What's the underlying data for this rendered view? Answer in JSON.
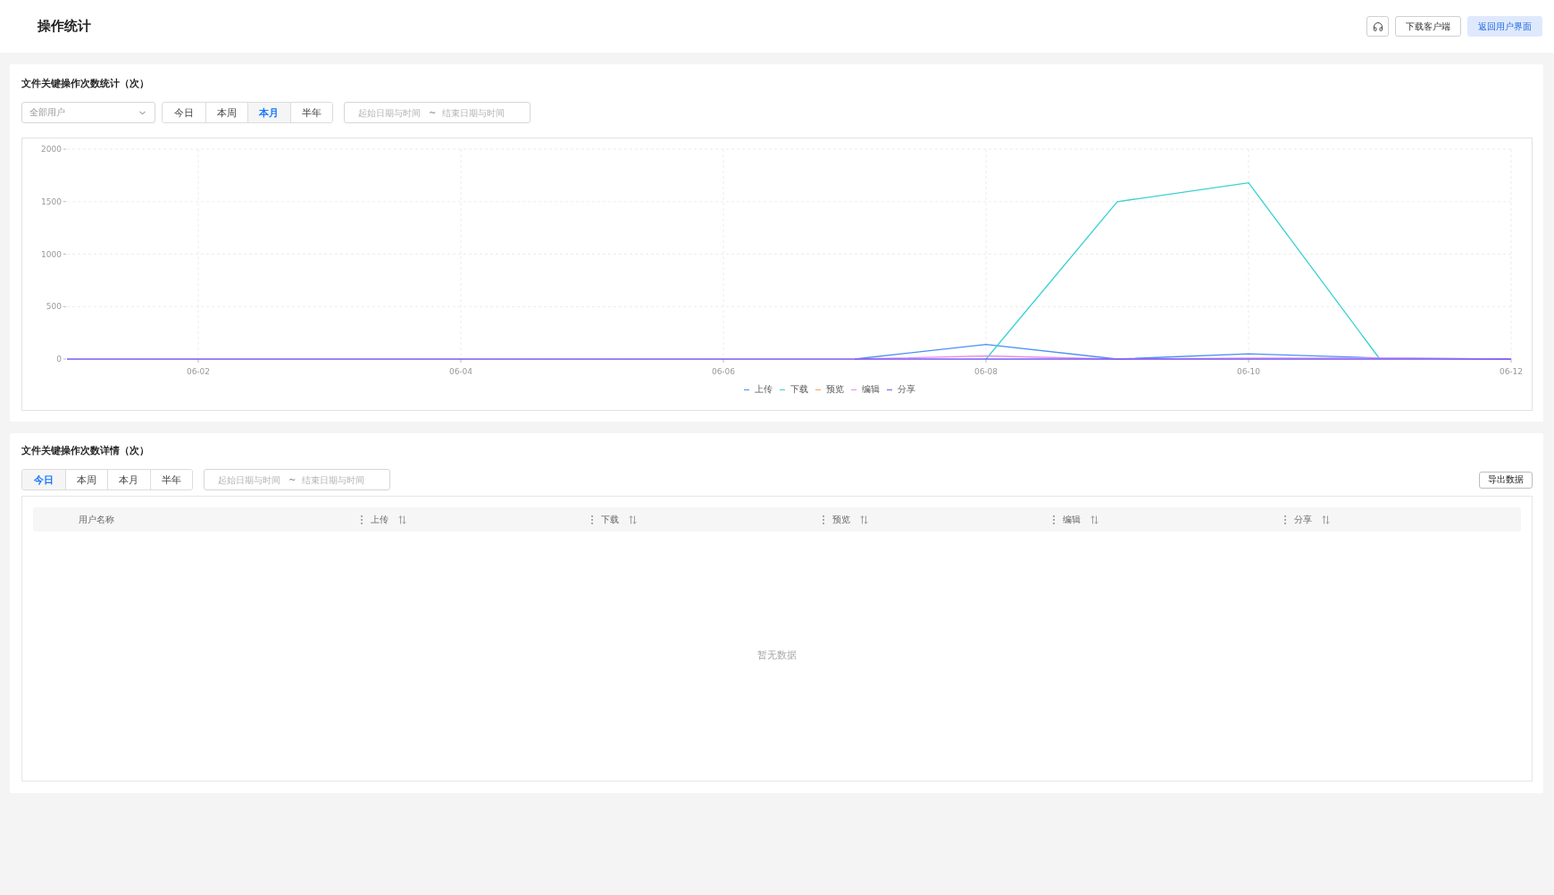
{
  "header": {
    "title": "操作统计",
    "buttons": [
      {
        "kind": "default",
        "label": "下载客户端"
      },
      {
        "kind": "primary",
        "label": "返回用户界面"
      }
    ]
  },
  "operation_stats": {
    "title": "文件关键操作次数统计（次）",
    "user_select": {
      "placeholder": "全部用户"
    },
    "periods": [
      {
        "label": "今日",
        "selected": false
      },
      {
        "label": "本周",
        "selected": false
      },
      {
        "label": "本月",
        "selected": true
      },
      {
        "label": "半年",
        "selected": false
      }
    ],
    "date_range": {
      "start_placeholder": "起始日期与时间",
      "separator": "~",
      "end_placeholder": "结束日期与时间"
    },
    "chart_data": {
      "type": "line",
      "categories": [
        null,
        "06-02",
        null,
        "06-04",
        null,
        "06-06",
        null,
        "06-08",
        null,
        "06-10",
        null,
        "06-12"
      ],
      "series": [
        {
          "name": "上传",
          "color": "#4a8ff5",
          "values": [
            null,
            null,
            null,
            null,
            null,
            null,
            0,
            140,
            0,
            50,
            10,
            0
          ]
        },
        {
          "name": "下载",
          "color": "#36d1d1",
          "values": [
            null,
            null,
            null,
            null,
            null,
            null,
            null,
            0,
            1500,
            1680,
            0,
            null
          ]
        },
        {
          "name": "预览",
          "color": "#f5a05a",
          "values": [
            null,
            null,
            null,
            null,
            null,
            null,
            null,
            null,
            null,
            null,
            null,
            null
          ]
        },
        {
          "name": "编辑",
          "color": "#e48ff0",
          "values": [
            null,
            null,
            null,
            null,
            null,
            null,
            0,
            30,
            0,
            10,
            10,
            0
          ]
        },
        {
          "name": "分享",
          "color": "#7d5cf5",
          "values": [
            0,
            0,
            0,
            0,
            0,
            0,
            0,
            0,
            0,
            0,
            0,
            0
          ]
        }
      ],
      "ylim": [
        0,
        2000
      ],
      "yticks": [
        0,
        500,
        1000,
        1500,
        2000
      ],
      "grid": true,
      "legend": true
    }
  },
  "operation_details": {
    "title": "文件关键操作次数详情（次）",
    "periods": [
      {
        "label": "今日",
        "selected": true
      },
      {
        "label": "本周",
        "selected": false
      },
      {
        "label": "本月",
        "selected": false
      },
      {
        "label": "半年",
        "selected": false
      }
    ],
    "date_range": {
      "start_placeholder": "起始日期与时间",
      "separator": "~",
      "end_placeholder": "结束日期与时间"
    },
    "export_button": "导出数据",
    "table": {
      "columns": [
        {
          "label": "用户名称",
          "sortable": false
        },
        {
          "label": "上传",
          "sortable": true
        },
        {
          "label": "下载",
          "sortable": true
        },
        {
          "label": "预览",
          "sortable": true
        },
        {
          "label": "编辑",
          "sortable": true
        },
        {
          "label": "分享",
          "sortable": true
        }
      ],
      "empty_text": "暂无数据"
    }
  }
}
